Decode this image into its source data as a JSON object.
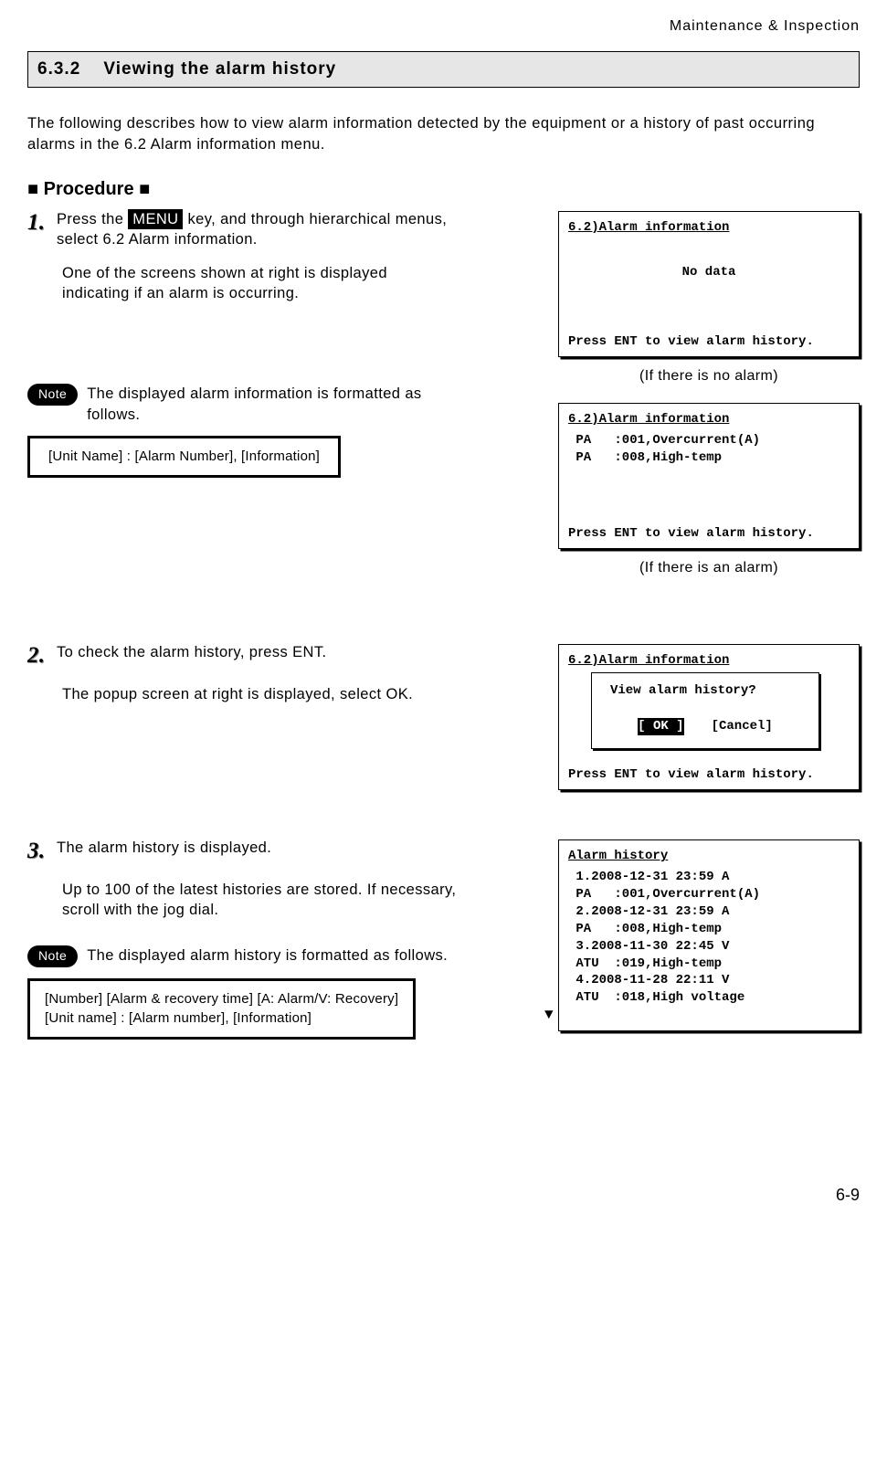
{
  "header": {
    "crumb": "Maintenance & Inspection"
  },
  "section": {
    "number": "6.3.2",
    "title": "Viewing the alarm history"
  },
  "intro": "The following describes how to view alarm information detected by the equipment or a history of past occurring alarms in the 6.2 Alarm information menu.",
  "procedure_heading": "■ Procedure ■",
  "menu_key_label": "MENU",
  "steps": {
    "s1": {
      "num": "1.",
      "title_pre": "Press the ",
      "title_post": " key, and through hierarchical menus, select 6.2 Alarm information.",
      "sub": "One of the screens shown at right is displayed indicating if an alarm is occurring."
    },
    "s2": {
      "num": "2.",
      "title": "To check the alarm history, press ENT.",
      "sub": "The popup screen at right is displayed, select OK."
    },
    "s3": {
      "num": "3.",
      "title": "The alarm history is displayed.",
      "sub": "Up to 100 of the latest histories are stored. If necessary, scroll with the jog dial."
    }
  },
  "notes": {
    "label": "Note",
    "n1": {
      "text": "The displayed alarm information is formatted as follows.",
      "format": "[Unit Name] : [Alarm Number], [Information]"
    },
    "n2": {
      "text": "The displayed alarm history is formatted as follows.",
      "format": "[Number] [Alarm & recovery time] [A: Alarm/V: Recovery]\n[Unit name] : [Alarm number], [Information]"
    }
  },
  "screens": {
    "common_footer": "Press ENT to view alarm history.",
    "info_title": "6.2)Alarm information",
    "no_alarm": {
      "body": "No data",
      "caption": "(If there is no alarm)"
    },
    "with_alarm": {
      "body": " PA   :001,Overcurrent(A)\n PA   :008,High-temp",
      "caption": "(If there is an alarm)"
    },
    "popup": {
      "msg": "View alarm history?",
      "ok": "[ OK ]",
      "cancel": "[Cancel]"
    },
    "history": {
      "title": "Alarm history",
      "body": " 1.2008-12-31 23:59 A\n PA   :001,Overcurrent(A)\n 2.2008-12-31 23:59 A\n PA   :008,High-temp\n 3.2008-11-30 22:45 V\n ATU  :019,High-temp\n 4.2008-11-28 22:11 V\n ATU  :018,High voltage",
      "arrow": "▼"
    }
  },
  "page_number": "6-9"
}
